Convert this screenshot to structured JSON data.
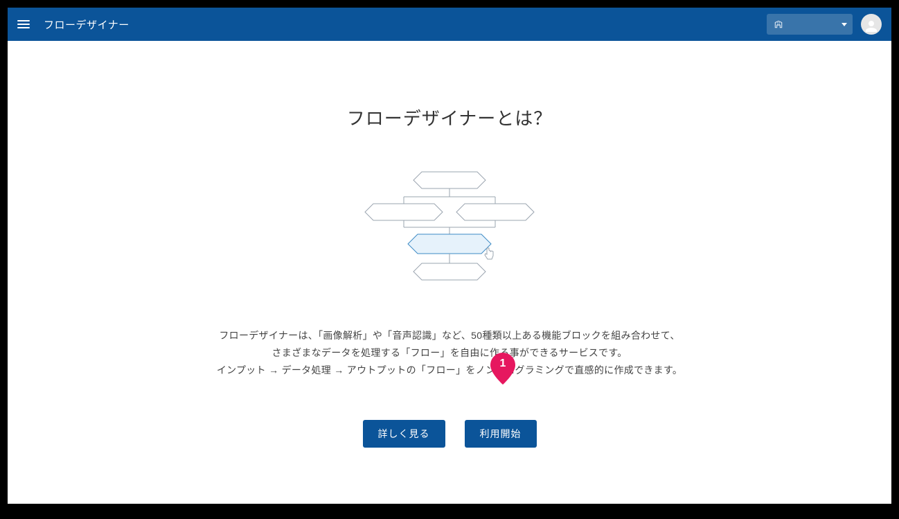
{
  "header": {
    "title": "フローデザイナー",
    "org_select_text": ""
  },
  "main": {
    "heading": "フローデザイナーとは？",
    "desc_line1": "フローデザイナーは、「画像解析」や「音声認識」など、50種類以上ある機能ブロックを組み合わせて、",
    "desc_line2": "さまざまなデータを処理する「フロー」を自由に作る事ができるサービスです。",
    "desc_line3": "インプット → データ処理 → アウトプットの「フロー」をノンプログラミングで直感的に作成できます。"
  },
  "buttons": {
    "learn_more": "詳しく見る",
    "start": "利用開始"
  },
  "marker": {
    "number": "1"
  }
}
